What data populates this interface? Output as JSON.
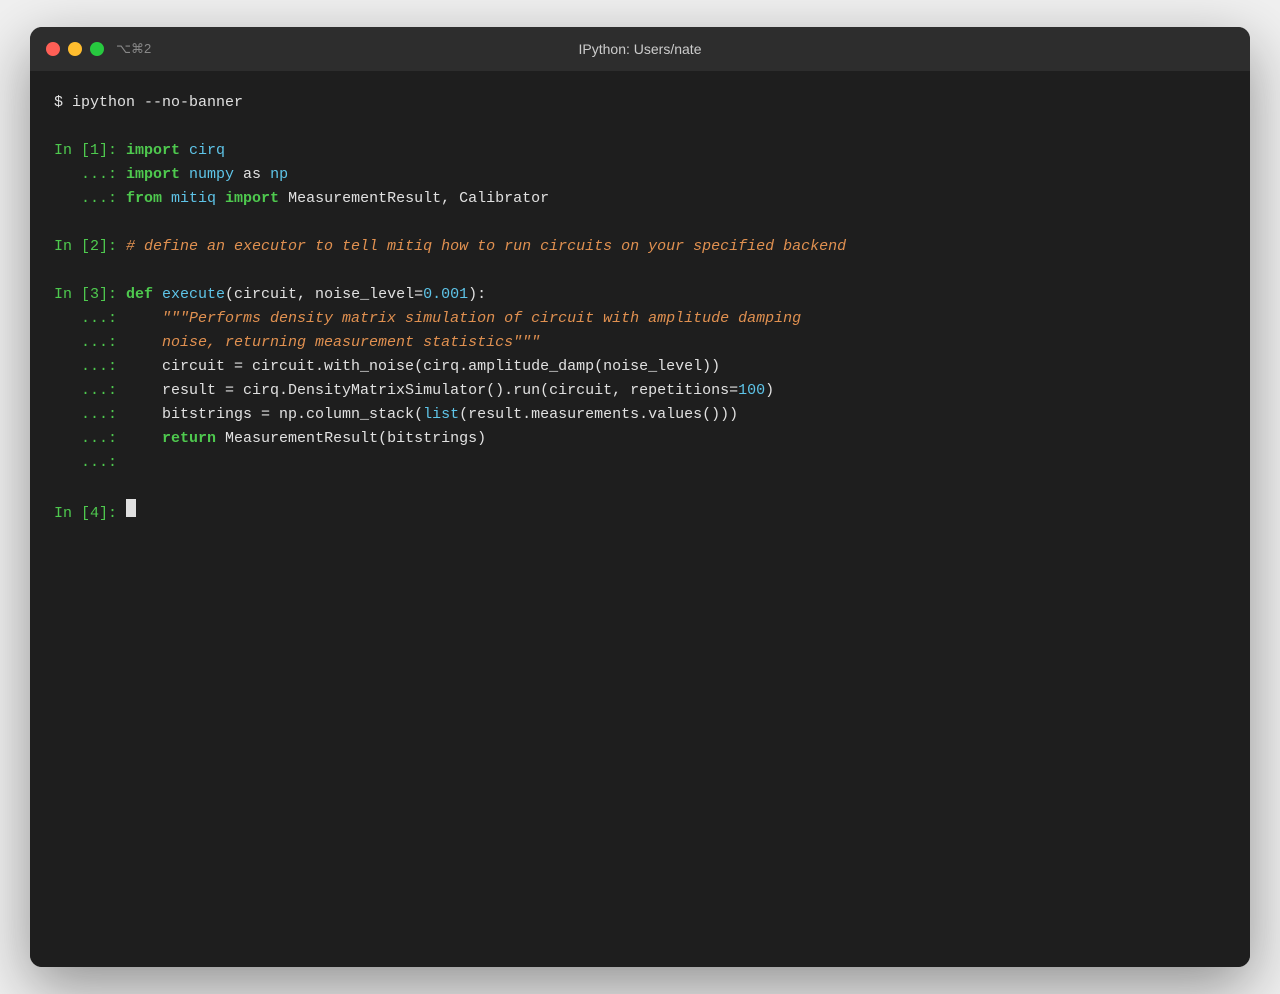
{
  "window": {
    "title": "IPython: Users/nate",
    "shortcut": "⌥⌘2"
  },
  "terminal": {
    "shell_command": "$ ipython --no-banner",
    "blocks": [
      {
        "id": "1",
        "lines": [
          {
            "prompt": "In [1]:",
            "content": [
              {
                "text": "import ",
                "cls": "c-keyword"
              },
              {
                "text": "cirq",
                "cls": "c-cyan"
              }
            ]
          },
          {
            "prompt": "   ...:",
            "content": [
              {
                "text": "import ",
                "cls": "c-keyword"
              },
              {
                "text": "numpy ",
                "cls": "c-cyan"
              },
              {
                "text": "as",
                "cls": "c-white"
              },
              {
                "text": " np",
                "cls": "c-cyan"
              }
            ]
          },
          {
            "prompt": "   ...:",
            "content": [
              {
                "text": "from ",
                "cls": "c-keyword"
              },
              {
                "text": "mitiq ",
                "cls": "c-cyan"
              },
              {
                "text": "import",
                "cls": "c-keyword"
              },
              {
                "text": " MeasurementResult, Calibrator",
                "cls": "c-white"
              }
            ]
          }
        ]
      },
      {
        "id": "2",
        "lines": [
          {
            "prompt": "In [2]:",
            "content": [
              {
                "text": "# define an executor to tell mitiq how to run circuits on your specified backend",
                "cls": "c-comment"
              }
            ]
          }
        ]
      },
      {
        "id": "3",
        "lines": [
          {
            "prompt": "In [3]:",
            "content": [
              {
                "text": "def ",
                "cls": "c-keyword"
              },
              {
                "text": "execute",
                "cls": "c-func"
              },
              {
                "text": "(circuit, noise_level=",
                "cls": "c-white"
              },
              {
                "text": "0.001",
                "cls": "c-number"
              },
              {
                "text": "):",
                "cls": "c-white"
              }
            ]
          },
          {
            "prompt": "   ...:",
            "content": [
              {
                "text": "    \"\"\"Performs density matrix simulation of circuit with amplitude damping",
                "cls": "c-comment"
              }
            ]
          },
          {
            "prompt": "   ...:",
            "content": [
              {
                "text": "    noise, returning measurement statistics\"\"\"",
                "cls": "c-comment"
              }
            ]
          },
          {
            "prompt": "   ...:",
            "content": [
              {
                "text": "    circuit = circuit.with_noise(cirq.amplitude_damp(noise_level))",
                "cls": "c-white"
              }
            ]
          },
          {
            "prompt": "   ...:",
            "content": [
              {
                "text": "    result = cirq.DensityMatrixSimulator().run(circuit, repetitions=",
                "cls": "c-white"
              },
              {
                "text": "100",
                "cls": "c-number"
              },
              {
                "text": ")",
                "cls": "c-white"
              }
            ]
          },
          {
            "prompt": "   ...:",
            "content": [
              {
                "text": "    bitstrings = np.column_stack(",
                "cls": "c-white"
              },
              {
                "text": "list",
                "cls": "c-cyan"
              },
              {
                "text": "(result.measurements.values()))",
                "cls": "c-white"
              }
            ]
          },
          {
            "prompt": "   ...:",
            "content": [
              {
                "text": "    ",
                "cls": "c-white"
              },
              {
                "text": "return",
                "cls": "c-keyword"
              },
              {
                "text": " MeasurementResult(bitstrings)",
                "cls": "c-white"
              }
            ]
          },
          {
            "prompt": "   ...:",
            "content": [
              {
                "text": "",
                "cls": "c-white"
              }
            ]
          }
        ]
      },
      {
        "id": "4",
        "lines": [
          {
            "prompt": "In [4]:",
            "content": [],
            "cursor": true
          }
        ]
      }
    ]
  }
}
